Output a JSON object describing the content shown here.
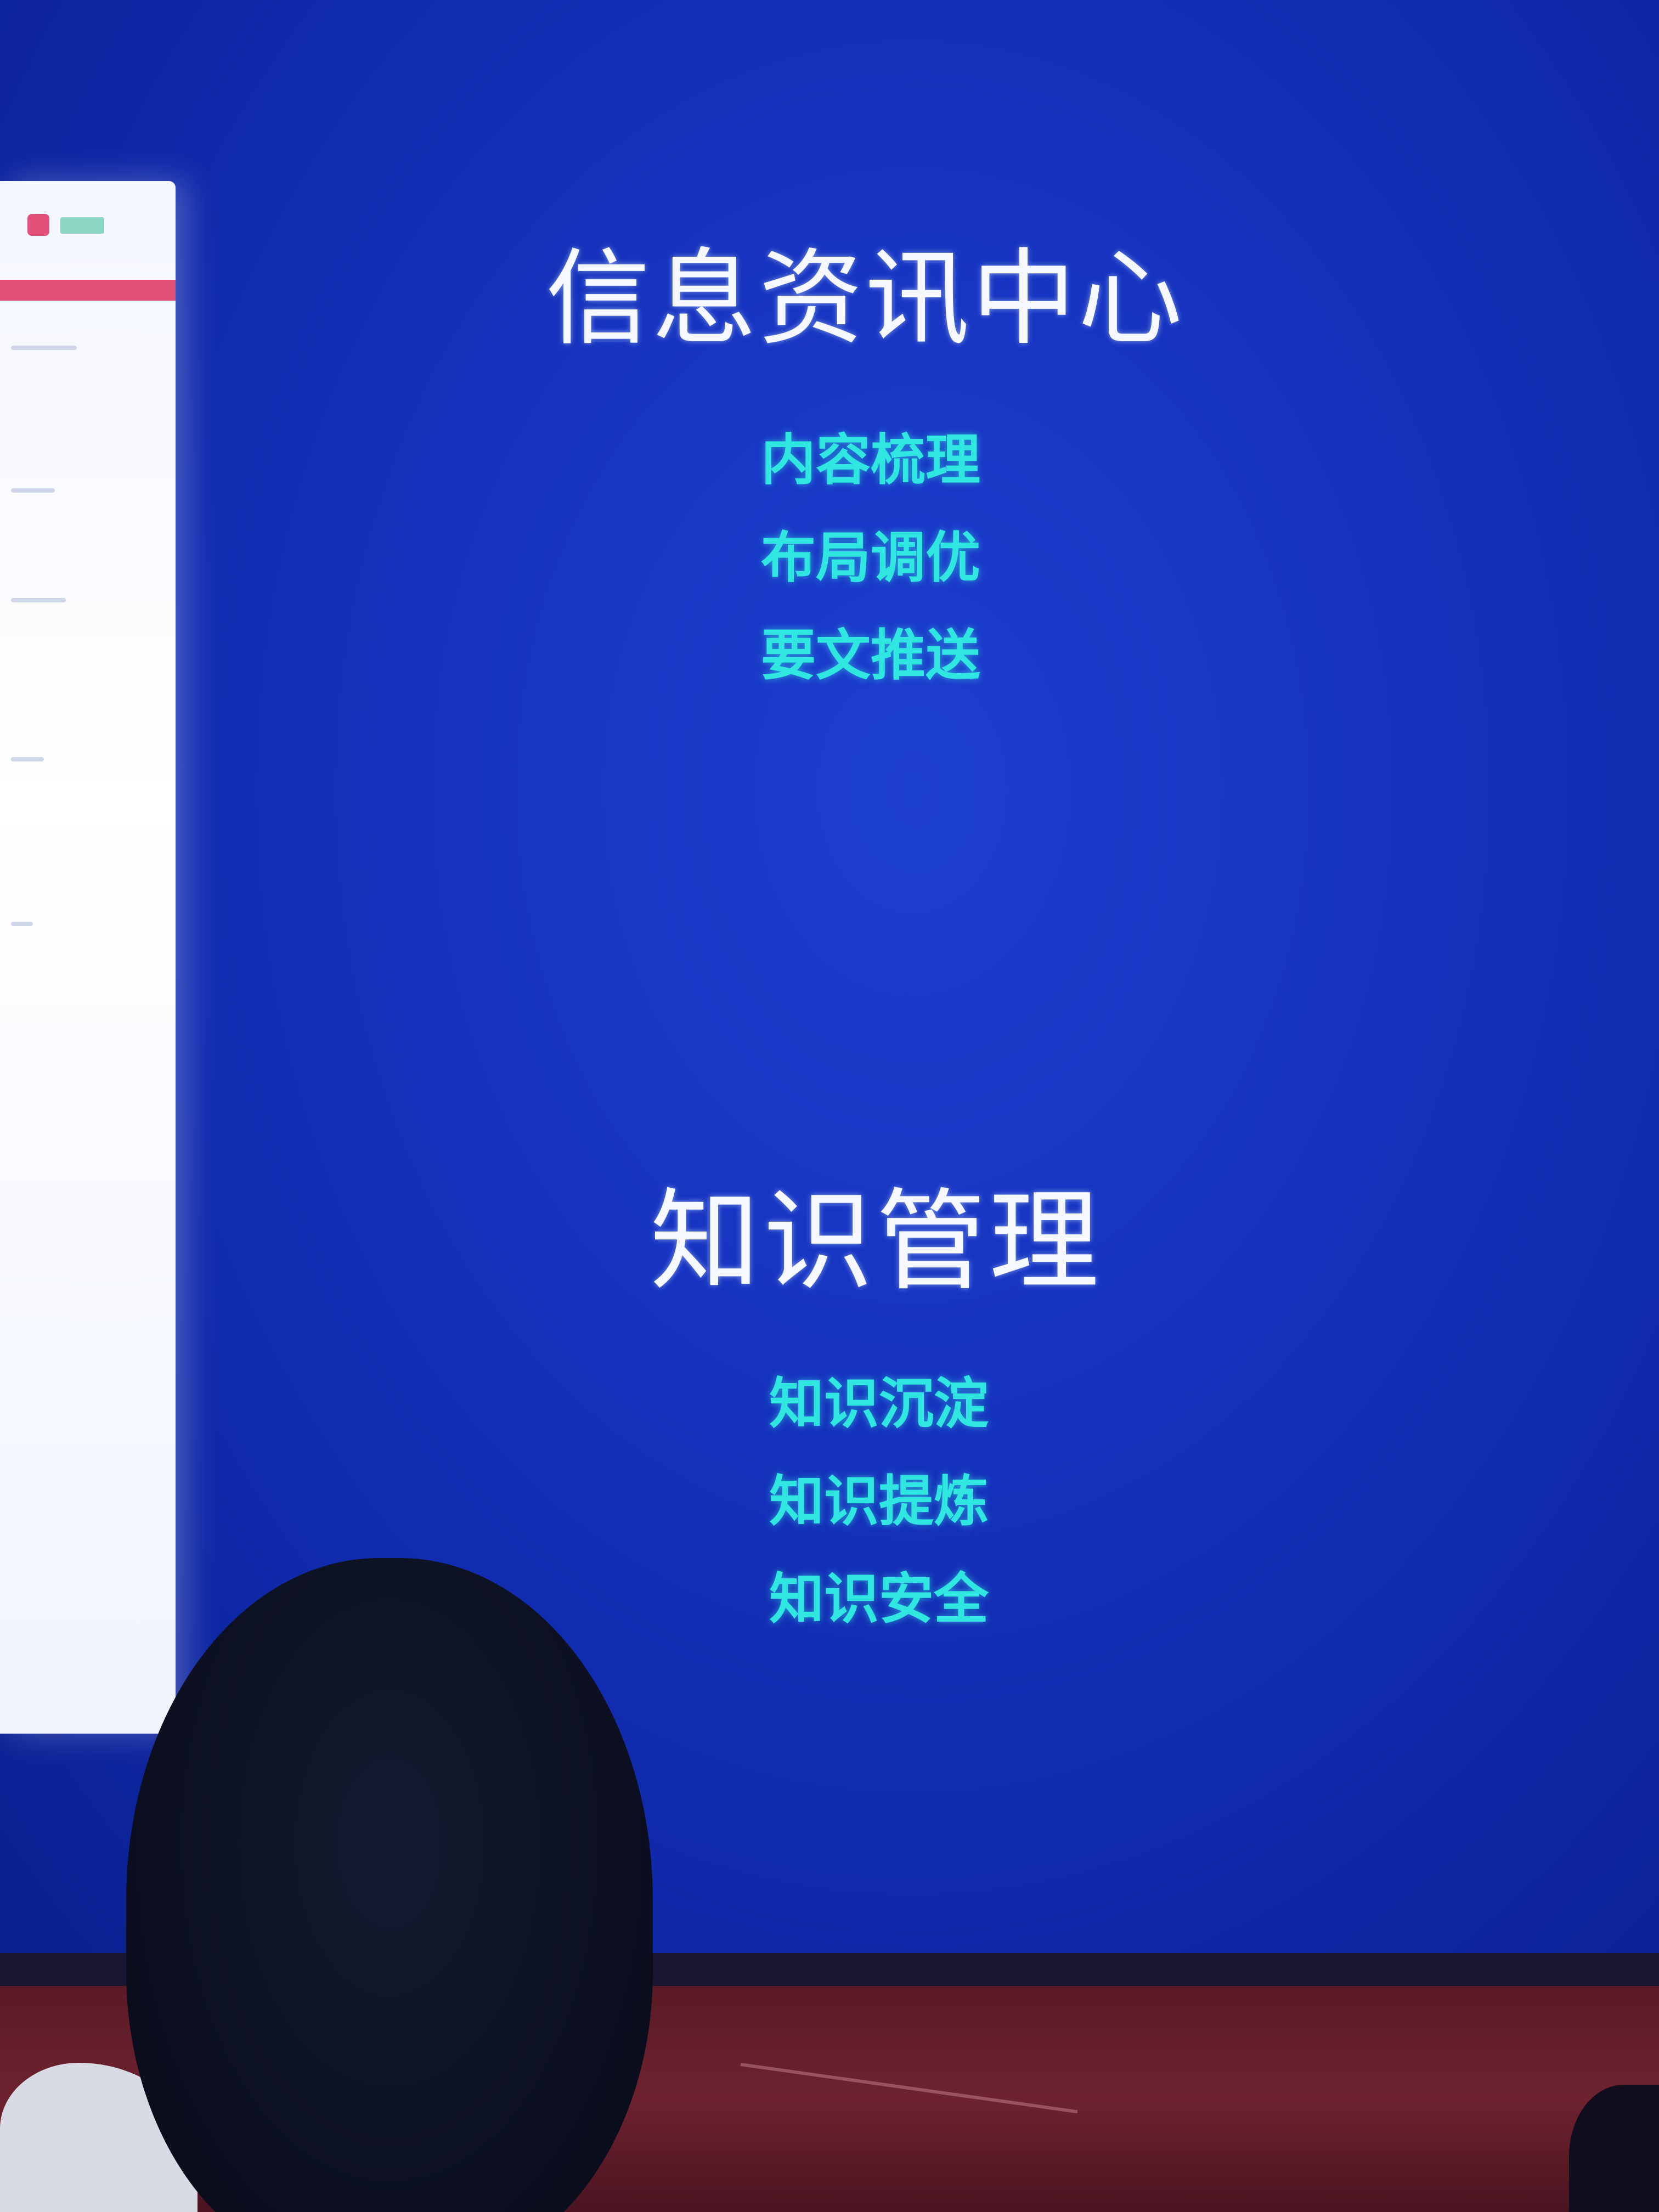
{
  "slide": {
    "section1": {
      "title": "信息资讯中心",
      "items": [
        "内容梳理",
        "布局调优",
        "要文推送"
      ]
    },
    "section2": {
      "title": "知识管理",
      "items": [
        "知识沉淀",
        "知识提炼",
        "知识安全"
      ]
    }
  },
  "colors": {
    "background": "#1634c0",
    "title": "#f6f8ff",
    "item": "#2fe6e0",
    "stage": "#6e2230"
  }
}
